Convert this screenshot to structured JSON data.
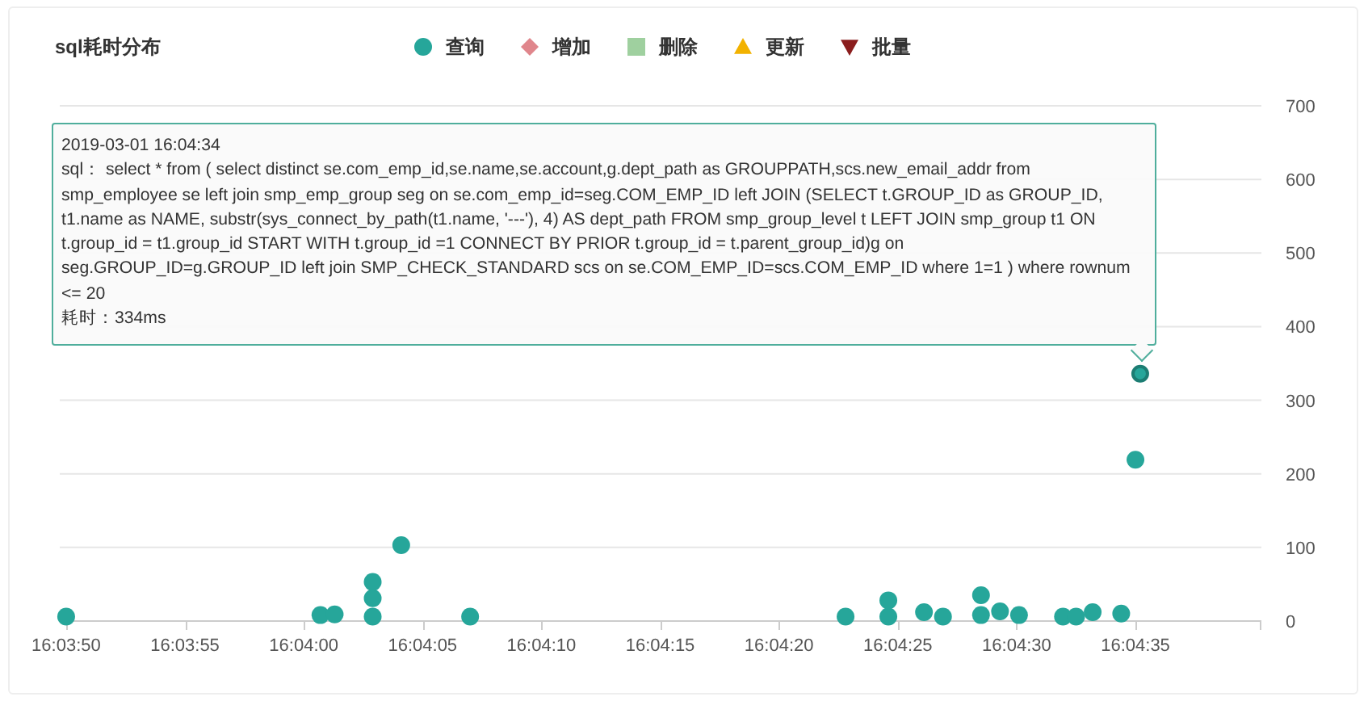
{
  "panel": {
    "title": "sql耗时分布"
  },
  "chart_data": {
    "type": "scatter",
    "series": [
      {
        "name": "查询",
        "color": "#26a69a",
        "values": [
          5,
          7,
          8,
          5,
          30,
          52,
          102,
          5,
          5,
          5,
          27,
          11,
          5,
          7,
          34,
          12,
          7,
          5,
          5,
          11,
          9,
          218,
          335
        ]
      },
      {
        "name": "增加",
        "color": "#e0868c",
        "values": [
          null,
          null,
          null,
          null,
          null,
          null,
          null,
          null,
          null,
          null,
          null,
          null,
          null,
          null,
          null,
          null,
          null,
          null,
          null,
          null,
          null,
          null,
          null
        ]
      },
      {
        "name": "删除",
        "color": "#9fd09f",
        "values": [
          null,
          null,
          null,
          null,
          null,
          null,
          null,
          null,
          null,
          null,
          null,
          null,
          null,
          null,
          null,
          null,
          null,
          null,
          null,
          null,
          null,
          null,
          null
        ]
      },
      {
        "name": "更新",
        "color": "#f2b200",
        "values": [
          null,
          null,
          null,
          null,
          null,
          null,
          null,
          null,
          null,
          null,
          null,
          null,
          null,
          null,
          null,
          null,
          null,
          null,
          null,
          null,
          null,
          null,
          null
        ]
      },
      {
        "name": "批量",
        "color": "#8b1e1e",
        "values": [
          null,
          null,
          null,
          null,
          null,
          null,
          null,
          null,
          null,
          null,
          null,
          null,
          null,
          null,
          null,
          null,
          null,
          null,
          null,
          null,
          null,
          null,
          null
        ]
      }
    ],
    "grid": true,
    "x": [
      57830,
      57840.7,
      57841.3,
      57842.9,
      57842.9,
      57842.9,
      57844.1,
      57847,
      57862.8,
      57864.6,
      57864.6,
      57866.1,
      57866.9,
      57868.5,
      57868.5,
      57869.3,
      57870.1,
      57871.95,
      57872.5,
      57873.2,
      57874.4,
      57875,
      57875.2
    ],
    "xlim": [
      57829.73,
      57880.3
    ],
    "ylim": [
      0,
      700
    ],
    "xticks": [
      {
        "value": 57830,
        "label": "16:03:50"
      },
      {
        "value": 57835,
        "label": "16:03:55"
      },
      {
        "value": 57840,
        "label": "16:04:00"
      },
      {
        "value": 57845,
        "label": "16:04:05"
      },
      {
        "value": 57850,
        "label": "16:04:10"
      },
      {
        "value": 57855,
        "label": "16:04:15"
      },
      {
        "value": 57860,
        "label": "16:04:20"
      },
      {
        "value": 57865,
        "label": "16:04:25"
      },
      {
        "value": 57870,
        "label": "16:04:30"
      },
      {
        "value": 57875,
        "label": "16:04:35"
      }
    ],
    "yticks": [
      0,
      100,
      200,
      300,
      400,
      500,
      600,
      700
    ]
  },
  "tooltip": {
    "time": "2019-03-01 16:04:34",
    "lines": [
      "sql：  select * from ( select distinct se.com_emp_id,se.name,se.account,g.dept_path as GROUPPATH,scs.new_email_addr from",
      "smp_employee se left join smp_emp_group seg on se.com_emp_id=seg.COM_EMP_ID left JOIN (SELECT t.GROUP_ID as GROUP_ID,",
      "t1.name as NAME, substr(sys_connect_by_path(t1.name, '---'), 4) AS dept_path FROM smp_group_level t LEFT JOIN smp_group t1 ON",
      "t.group_id = t1.group_id START WITH t.group_id =1 CONNECT BY PRIOR t.group_id = t.parent_group_id)g on",
      "seg.GROUP_ID=g.GROUP_ID left join SMP_CHECK_STANDARD scs on se.COM_EMP_ID=scs.COM_EMP_ID where 1=1 ) where rownum",
      "<= 20"
    ],
    "duration": "耗时：334ms"
  }
}
